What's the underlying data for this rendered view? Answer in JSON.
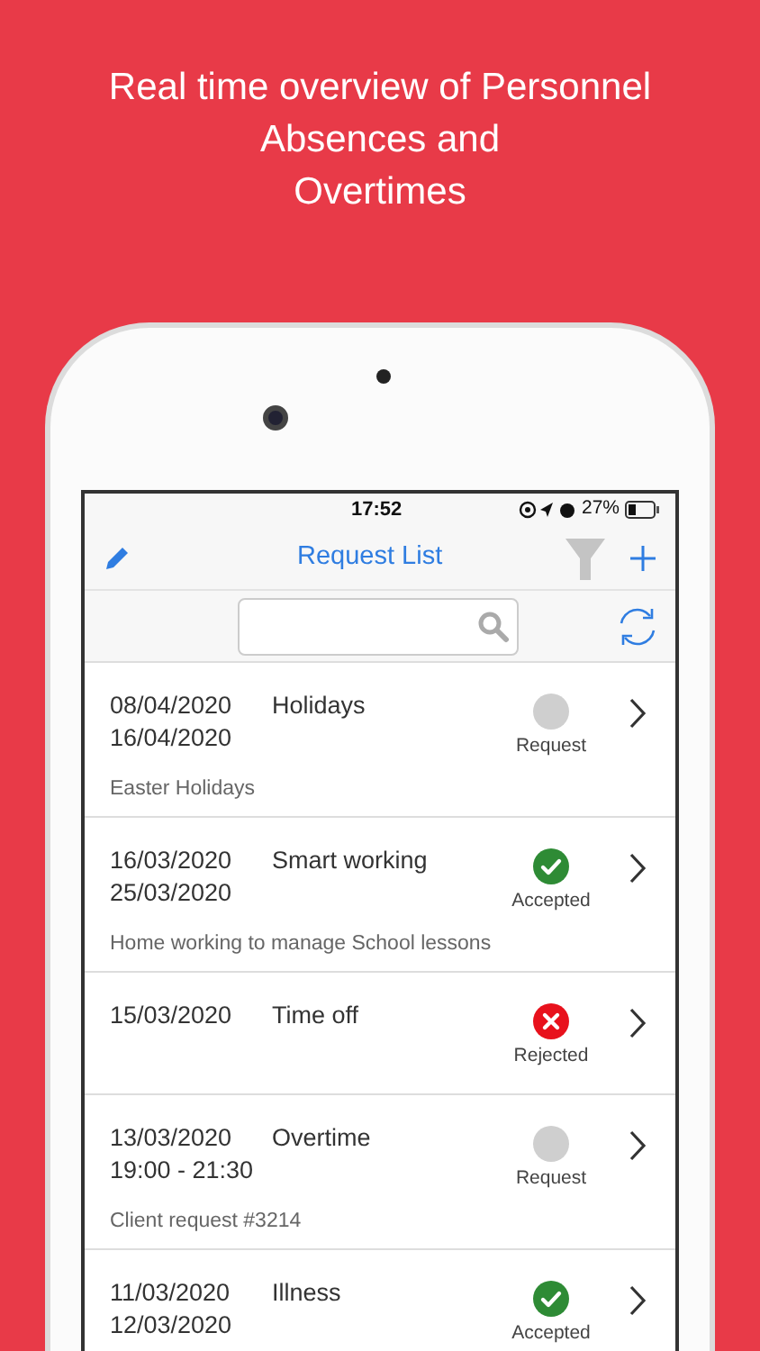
{
  "headline": [
    "Real time overview of Personnel",
    "Absences and",
    "Overtimes"
  ],
  "status_bar": {
    "time": "17:52",
    "battery": "27%"
  },
  "nav": {
    "title": "Request List"
  },
  "requests": [
    {
      "date_start": "08/04/2020",
      "date_end": "16/04/2020",
      "type": "Holidays",
      "description": "Easter Holidays",
      "status": "Request",
      "kind": "request"
    },
    {
      "date_start": "16/03/2020",
      "date_end": "25/03/2020",
      "type": "Smart working",
      "description": "Home working to manage School lessons",
      "status": "Accepted",
      "kind": "accepted"
    },
    {
      "date_start": "15/03/2020",
      "type": "Time off",
      "status": "Rejected",
      "kind": "rejected"
    },
    {
      "date_start": "13/03/2020",
      "date_end": "19:00 - 21:30",
      "type": "Overtime",
      "description": "Client request #3214",
      "status": "Request",
      "kind": "request"
    },
    {
      "date_start": "11/03/2020",
      "date_end": "12/03/2020",
      "type": "Illness",
      "status": "Accepted",
      "kind": "accepted"
    }
  ]
}
